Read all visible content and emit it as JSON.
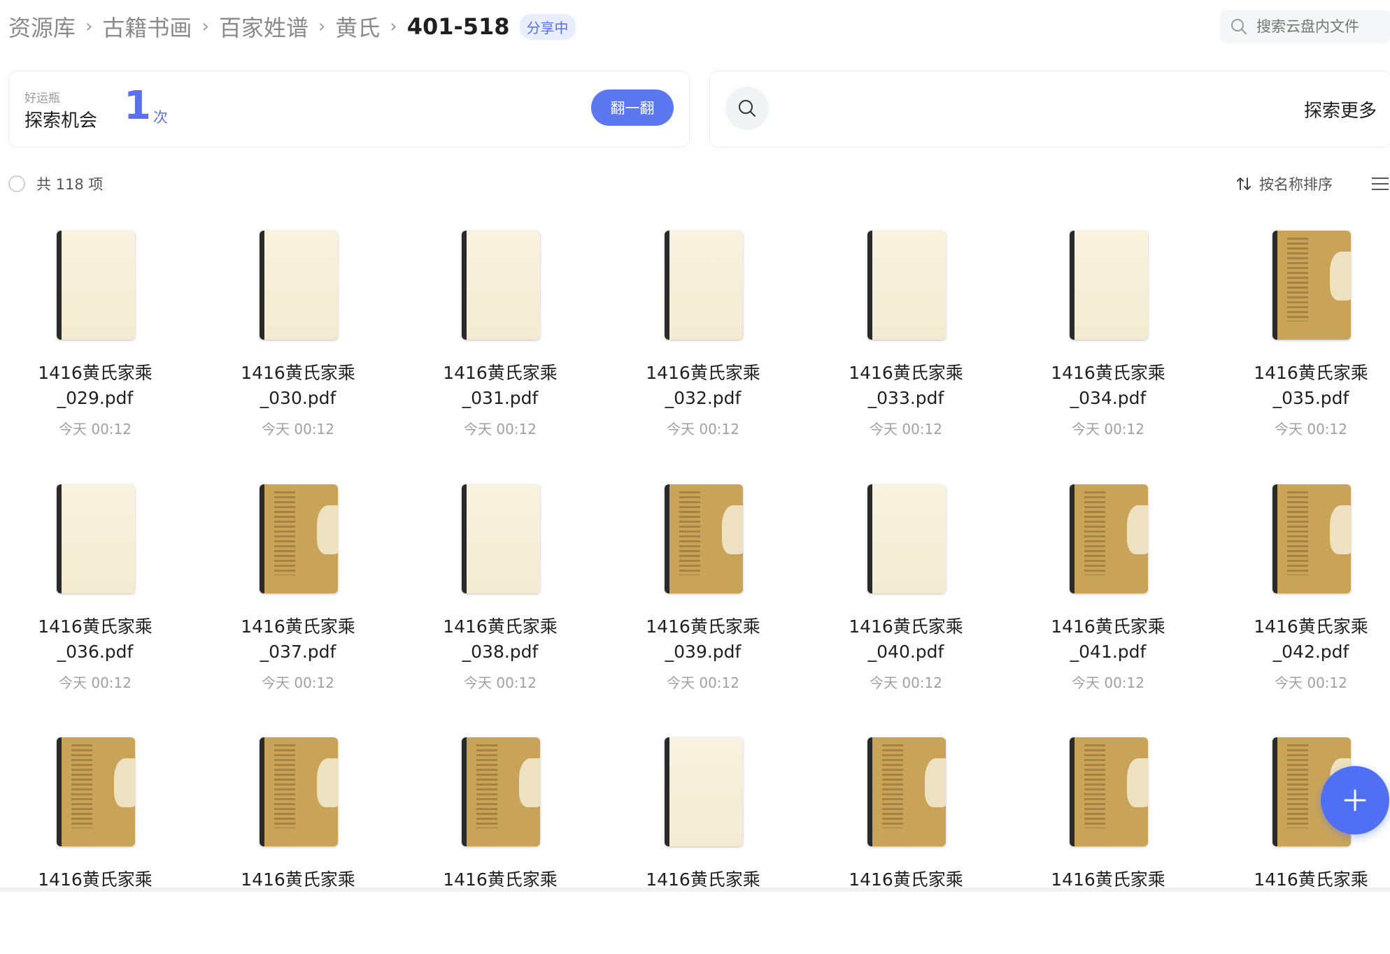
{
  "breadcrumb": {
    "items": [
      "资源库",
      "古籍书画",
      "百家姓谱",
      "黄氏"
    ],
    "current": "401-518",
    "badge": "分享中"
  },
  "search": {
    "placeholder": "搜索云盘内文件",
    "icon": "search-icon"
  },
  "lucky_card": {
    "subtitle": "好运瓶",
    "title": "探索机会",
    "count": "1",
    "unit": "次",
    "button_label": "翻一翻"
  },
  "explore_card": {
    "label": "探索更多",
    "icon": "search-icon"
  },
  "toolbar": {
    "total_label": "共 118 项",
    "sort_label": "按名称排序",
    "sort_icon": "sort-arrows-icon",
    "view_icon": "list-view-icon"
  },
  "files": [
    {
      "line1": "1416黄氏家乘",
      "line2": "_029.pdf",
      "time": "今天 00:12",
      "thumb": "blank"
    },
    {
      "line1": "1416黄氏家乘",
      "line2": "_030.pdf",
      "time": "今天 00:12",
      "thumb": "blank"
    },
    {
      "line1": "1416黄氏家乘",
      "line2": "_031.pdf",
      "time": "今天 00:12",
      "thumb": "blank"
    },
    {
      "line1": "1416黄氏家乘",
      "line2": "_032.pdf",
      "time": "今天 00:12",
      "thumb": "blank"
    },
    {
      "line1": "1416黄氏家乘",
      "line2": "_033.pdf",
      "time": "今天 00:12",
      "thumb": "blank"
    },
    {
      "line1": "1416黄氏家乘",
      "line2": "_034.pdf",
      "time": "今天 00:12",
      "thumb": "blank"
    },
    {
      "line1": "1416黄氏家乘",
      "line2": "_035.pdf",
      "time": "今天 00:12",
      "thumb": "aged"
    },
    {
      "line1": "1416黄氏家乘",
      "line2": "_036.pdf",
      "time": "今天 00:12",
      "thumb": "blank"
    },
    {
      "line1": "1416黄氏家乘",
      "line2": "_037.pdf",
      "time": "今天 00:12",
      "thumb": "aged"
    },
    {
      "line1": "1416黄氏家乘",
      "line2": "_038.pdf",
      "time": "今天 00:12",
      "thumb": "blank"
    },
    {
      "line1": "1416黄氏家乘",
      "line2": "_039.pdf",
      "time": "今天 00:12",
      "thumb": "aged"
    },
    {
      "line1": "1416黄氏家乘",
      "line2": "_040.pdf",
      "time": "今天 00:12",
      "thumb": "blank"
    },
    {
      "line1": "1416黄氏家乘",
      "line2": "_041.pdf",
      "time": "今天 00:12",
      "thumb": "aged"
    },
    {
      "line1": "1416黄氏家乘",
      "line2": "_042.pdf",
      "time": "今天 00:12",
      "thumb": "aged"
    },
    {
      "line1": "1416黄氏家乘",
      "line2": "",
      "time": "",
      "thumb": "aged"
    },
    {
      "line1": "1416黄氏家乘",
      "line2": "",
      "time": "",
      "thumb": "aged"
    },
    {
      "line1": "1416黄氏家乘",
      "line2": "",
      "time": "",
      "thumb": "aged"
    },
    {
      "line1": "1416黄氏家乘",
      "line2": "",
      "time": "",
      "thumb": "blank"
    },
    {
      "line1": "1416黄氏家乘",
      "line2": "",
      "time": "",
      "thumb": "aged"
    },
    {
      "line1": "1416黄氏家乘",
      "line2": "",
      "time": "",
      "thumb": "aged"
    },
    {
      "line1": "1416黄氏家乘",
      "line2": "",
      "time": "",
      "thumb": "aged"
    }
  ],
  "fab": {
    "icon": "plus-icon"
  },
  "colors": {
    "accent": "#5b78f0",
    "badge_bg": "#e8edff",
    "muted": "#a0a0a0"
  }
}
